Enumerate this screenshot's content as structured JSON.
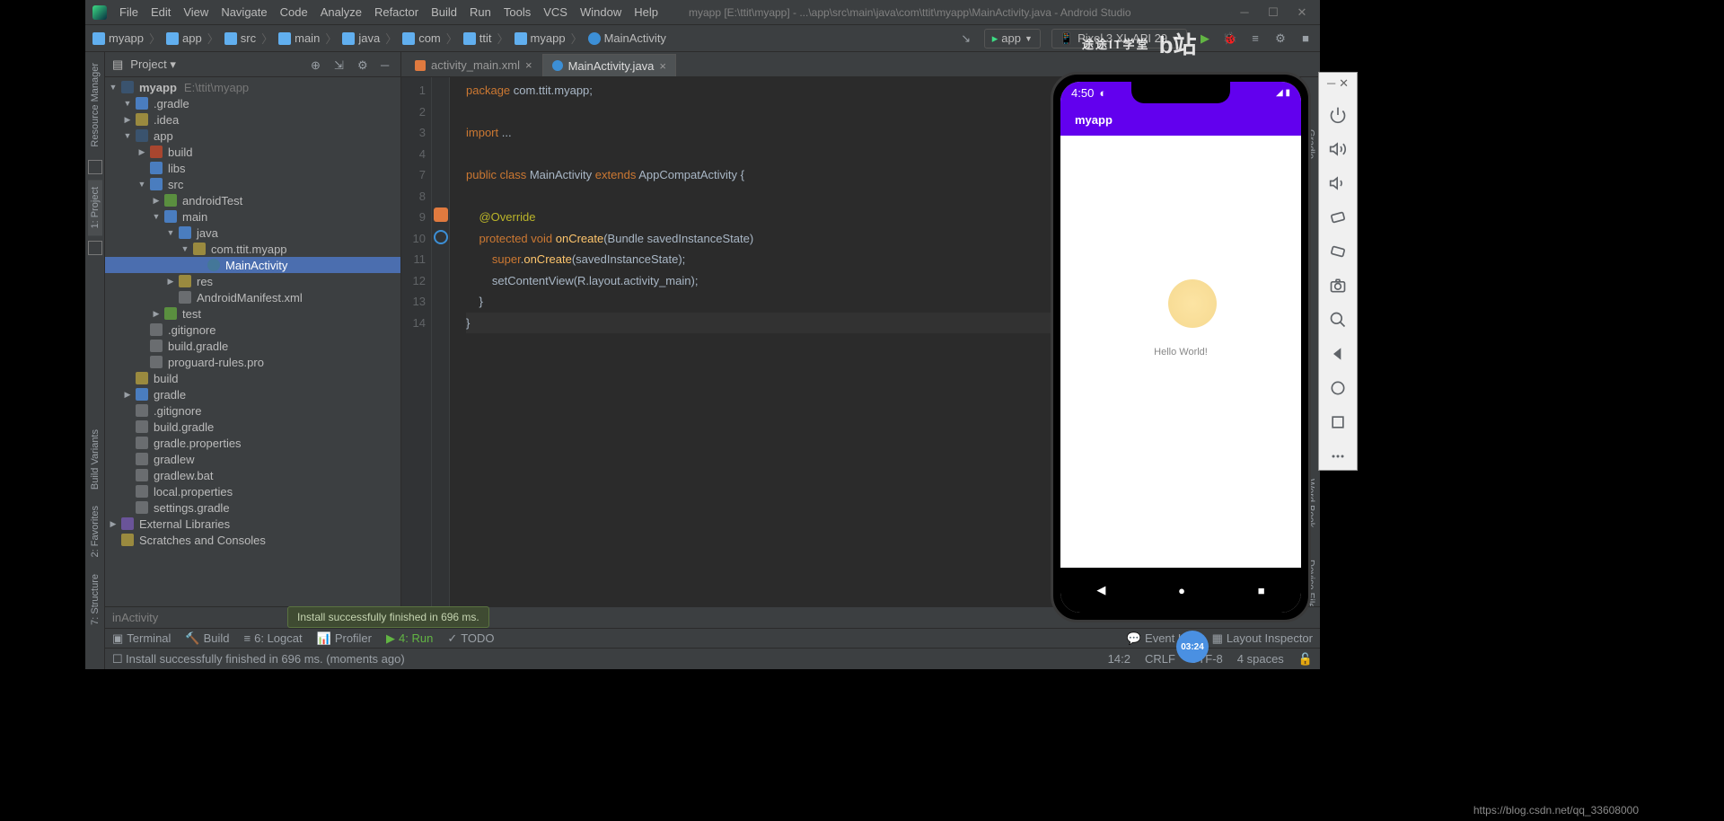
{
  "titlebar": {
    "menus": [
      "File",
      "Edit",
      "View",
      "Navigate",
      "Code",
      "Analyze",
      "Refactor",
      "Build",
      "Run",
      "Tools",
      "VCS",
      "Window",
      "Help"
    ],
    "project_path": "myapp [E:\\ttit\\myapp] - ...\\app\\src\\main\\java\\com\\ttit\\myapp\\MainActivity.java - Android Studio"
  },
  "breadcrumb": [
    "myapp",
    "app",
    "src",
    "main",
    "java",
    "com",
    "ttit",
    "myapp",
    "MainActivity"
  ],
  "toolbar": {
    "run_config": "app",
    "device": "Pixel 3 XL API 29"
  },
  "project_panel": {
    "title": "Project",
    "root_name": "myapp",
    "root_path": "E:\\ttit\\myapp",
    "tree": [
      {
        "d": 1,
        "arrow": "▼",
        "ico": "fld-blue",
        "label": ".gradle"
      },
      {
        "d": 1,
        "arrow": "▶",
        "ico": "fld-yellow",
        "label": ".idea"
      },
      {
        "d": 1,
        "arrow": "▼",
        "ico": "mod",
        "label": "app"
      },
      {
        "d": 2,
        "arrow": "▶",
        "ico": "fld-red",
        "label": "build"
      },
      {
        "d": 2,
        "arrow": "",
        "ico": "fld-blue",
        "label": "libs"
      },
      {
        "d": 2,
        "arrow": "▼",
        "ico": "fld-blue",
        "label": "src"
      },
      {
        "d": 3,
        "arrow": "▶",
        "ico": "fld-green",
        "label": "androidTest"
      },
      {
        "d": 3,
        "arrow": "▼",
        "ico": "fld-blue",
        "label": "main"
      },
      {
        "d": 4,
        "arrow": "▼",
        "ico": "fld-blue",
        "label": "java"
      },
      {
        "d": 5,
        "arrow": "▼",
        "ico": "fld-yellow",
        "label": "com.ttit.myapp"
      },
      {
        "d": 6,
        "arrow": "",
        "ico": "file-j",
        "label": "MainActivity",
        "sel": true
      },
      {
        "d": 4,
        "arrow": "▶",
        "ico": "fld-yellow",
        "label": "res"
      },
      {
        "d": 4,
        "arrow": "",
        "ico": "file-plain",
        "label": "AndroidManifest.xml"
      },
      {
        "d": 3,
        "arrow": "▶",
        "ico": "fld-green",
        "label": "test"
      },
      {
        "d": 2,
        "arrow": "",
        "ico": "file-plain",
        "label": ".gitignore"
      },
      {
        "d": 2,
        "arrow": "",
        "ico": "file-plain",
        "label": "build.gradle"
      },
      {
        "d": 2,
        "arrow": "",
        "ico": "file-plain",
        "label": "proguard-rules.pro"
      },
      {
        "d": 1,
        "arrow": "",
        "ico": "fld-yellow",
        "label": "build"
      },
      {
        "d": 1,
        "arrow": "▶",
        "ico": "fld-blue",
        "label": "gradle"
      },
      {
        "d": 1,
        "arrow": "",
        "ico": "file-plain",
        "label": ".gitignore"
      },
      {
        "d": 1,
        "arrow": "",
        "ico": "file-plain",
        "label": "build.gradle"
      },
      {
        "d": 1,
        "arrow": "",
        "ico": "file-plain",
        "label": "gradle.properties"
      },
      {
        "d": 1,
        "arrow": "",
        "ico": "file-plain",
        "label": "gradlew"
      },
      {
        "d": 1,
        "arrow": "",
        "ico": "file-plain",
        "label": "gradlew.bat"
      },
      {
        "d": 1,
        "arrow": "",
        "ico": "file-plain",
        "label": "local.properties"
      },
      {
        "d": 1,
        "arrow": "",
        "ico": "file-plain",
        "label": "settings.gradle"
      }
    ],
    "ext_lib": "External Libraries",
    "scratches": "Scratches and Consoles"
  },
  "tabs": [
    {
      "label": "activity_main.xml",
      "active": false
    },
    {
      "label": "MainActivity.java",
      "active": true
    }
  ],
  "code": {
    "line_count": 14,
    "caret_line": 14,
    "lines": [
      [
        {
          "c": "kw",
          "t": "package "
        },
        {
          "c": "",
          "t": "com.ttit.myapp;"
        }
      ],
      [],
      [
        {
          "c": "kw",
          "t": "import "
        },
        {
          "c": "",
          "t": "..."
        }
      ],
      [],
      [
        {
          "c": "kw",
          "t": "public class "
        },
        {
          "c": "cls",
          "t": "MainActivity "
        },
        {
          "c": "kw",
          "t": "extends "
        },
        {
          "c": "cls",
          "t": "AppCompatActivity "
        },
        {
          "c": "",
          "t": "{"
        }
      ],
      [],
      [
        {
          "c": "",
          "t": "    "
        },
        {
          "c": "ann",
          "t": "@Override"
        }
      ],
      [
        {
          "c": "",
          "t": "    "
        },
        {
          "c": "kw",
          "t": "protected void "
        },
        {
          "c": "fn",
          "t": "onCreate"
        },
        {
          "c": "",
          "t": "(Bundle savedInstanceState)"
        }
      ],
      [
        {
          "c": "",
          "t": "        "
        },
        {
          "c": "kw",
          "t": "super"
        },
        {
          "c": "",
          "t": "."
        },
        {
          "c": "fn",
          "t": "onCreate"
        },
        {
          "c": "",
          "t": "(savedInstanceState);"
        }
      ],
      [
        {
          "c": "",
          "t": "        setContentView(R.layout."
        },
        {
          "c": "",
          "t": "activity_main"
        },
        {
          "c": "",
          "t": ");"
        }
      ],
      [
        {
          "c": "",
          "t": "    }"
        }
      ],
      [
        {
          "c": "",
          "t": "}"
        }
      ]
    ],
    "line_map": [
      1,
      2,
      3,
      4,
      7,
      8,
      9,
      10,
      11,
      12,
      13,
      14
    ]
  },
  "bottom_crumb": "inActivity",
  "install_toast": "Install successfully finished in 696 ms.",
  "bottom_tabs": {
    "left": [
      "Terminal",
      "Build",
      "6: Logcat",
      "Profiler",
      "4: Run",
      "TODO"
    ],
    "right": [
      "Event Log",
      "Layout Inspector"
    ]
  },
  "status_msg": "Install successfully finished in 696 ms. (moments ago)",
  "status_right": {
    "pos": "14:2",
    "crlf": "CRLF",
    "enc": "UTF-8",
    "indent": "4 spaces"
  },
  "emulator": {
    "time": "4:50",
    "app_title": "myapp",
    "hello": "Hello World!"
  },
  "left_tags": [
    "Resource Manager",
    "1: Project",
    "7: Structure",
    "Build Variants",
    "2: Favorites"
  ],
  "right_tags": [
    "Gradle",
    "Word Book",
    "Device File Explorer"
  ],
  "watermark": "途途IT学堂",
  "timestamp": "03:24",
  "url": "https://blog.csdn.net/qq_33608000"
}
